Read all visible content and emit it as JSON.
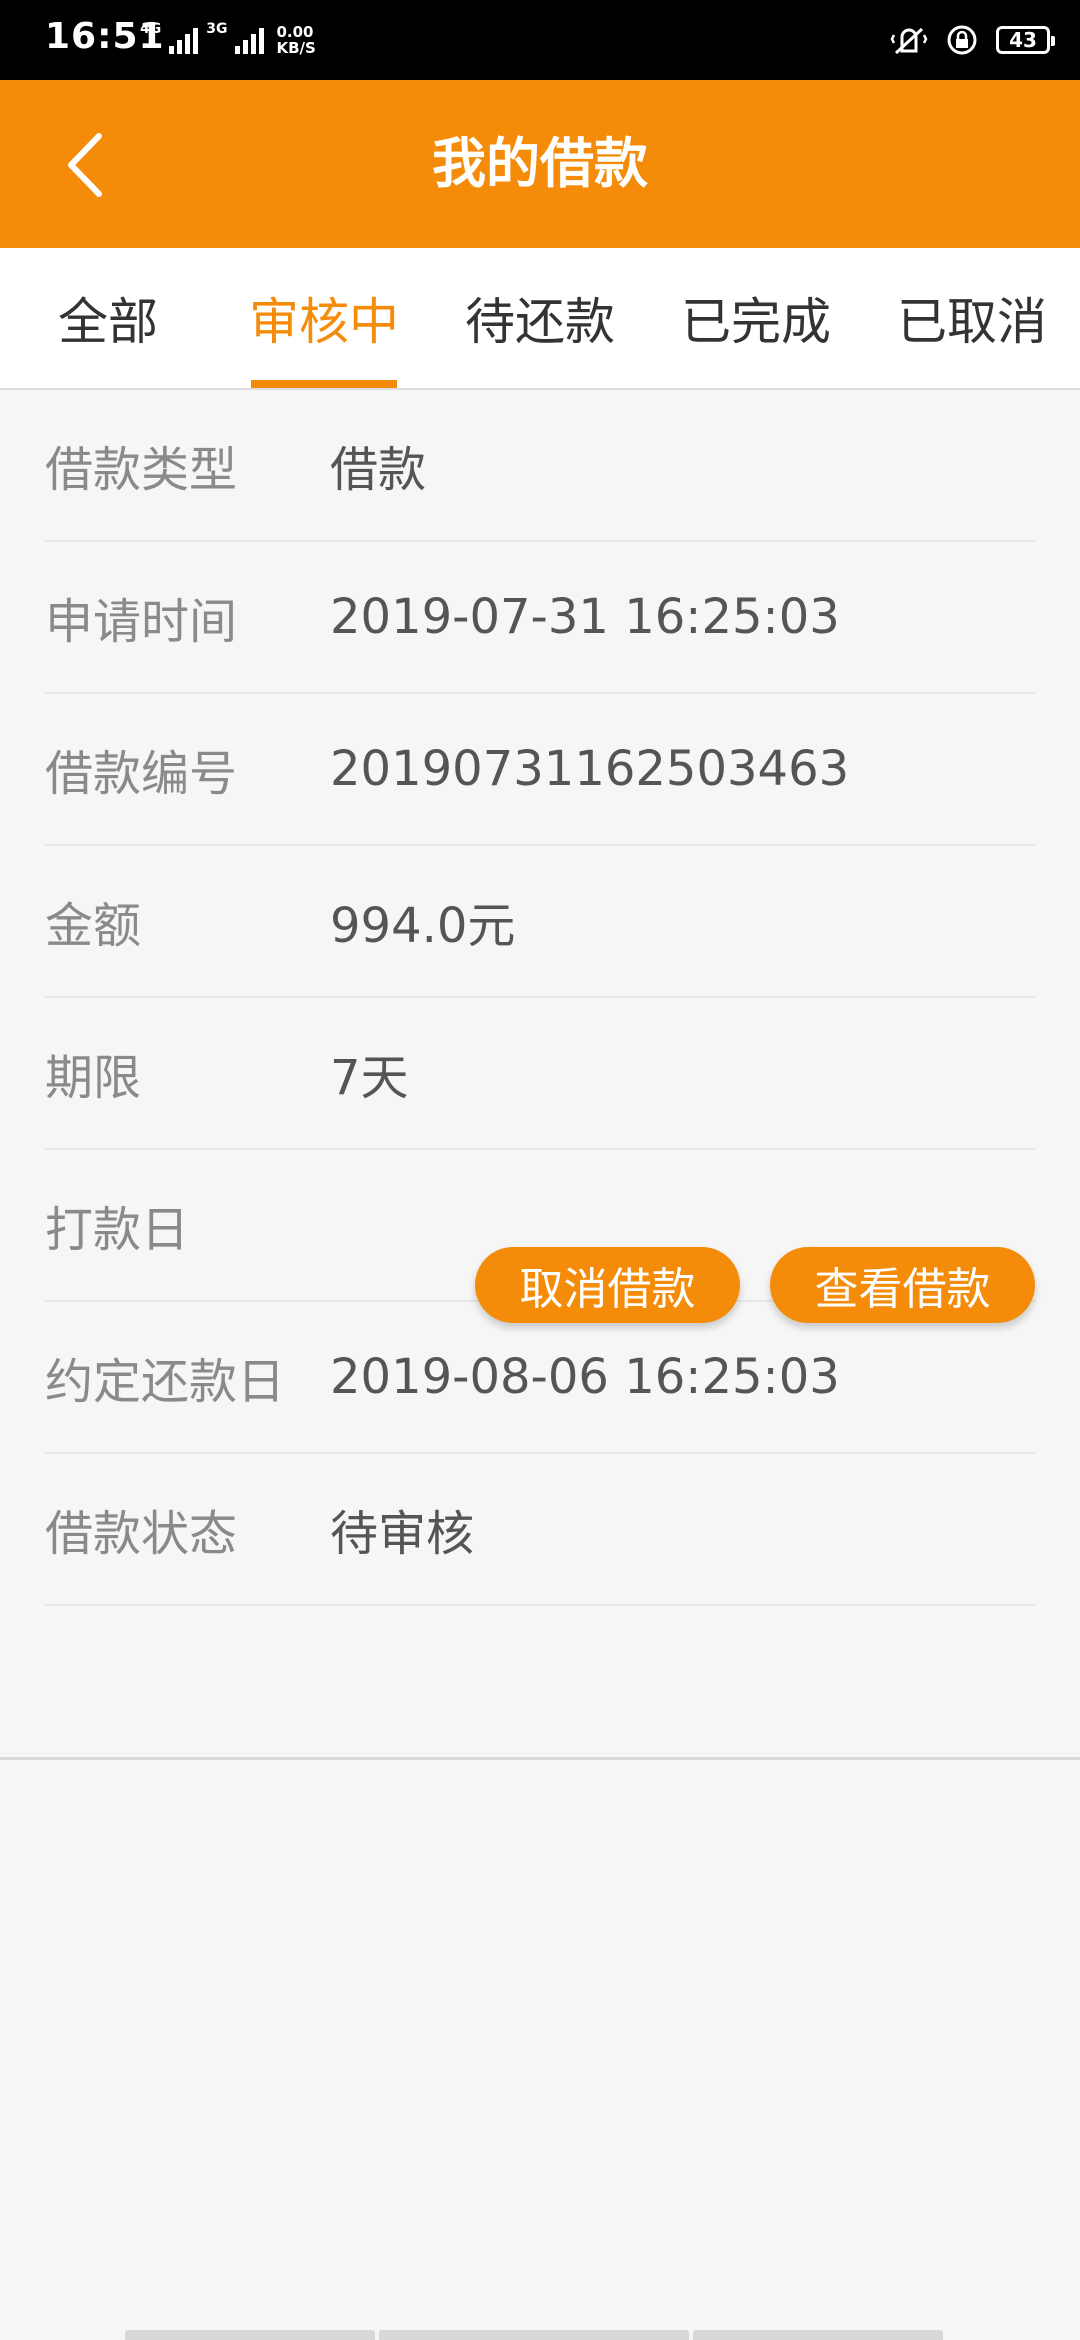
{
  "status_bar": {
    "time": "16:51",
    "network_1": "4G",
    "network_2": "3G",
    "speed_value": "0.00",
    "speed_unit": "KB/S",
    "battery": "43"
  },
  "header": {
    "title": "我的借款"
  },
  "tabs": [
    {
      "label": "全部"
    },
    {
      "label": "审核中"
    },
    {
      "label": "待还款"
    },
    {
      "label": "已完成"
    },
    {
      "label": "已取消"
    }
  ],
  "active_tab": "审核中",
  "details": [
    {
      "label": "借款类型",
      "value": "借款"
    },
    {
      "label": "申请时间",
      "value": "2019-07-31 16:25:03"
    },
    {
      "label": "借款编号",
      "value": "20190731162503463"
    },
    {
      "label": "金额",
      "value": "994.0元"
    },
    {
      "label": "期限",
      "value": "7天"
    },
    {
      "label": "打款日",
      "value": ""
    },
    {
      "label": "约定还款日",
      "value": "2019-08-06 16:25:03"
    },
    {
      "label": "借款状态",
      "value": "待审核"
    }
  ],
  "actions": {
    "cancel_label": "取消借款",
    "view_label": "查看借款"
  },
  "colors": {
    "accent": "#f48c0a",
    "background": "#f6f6f6"
  }
}
